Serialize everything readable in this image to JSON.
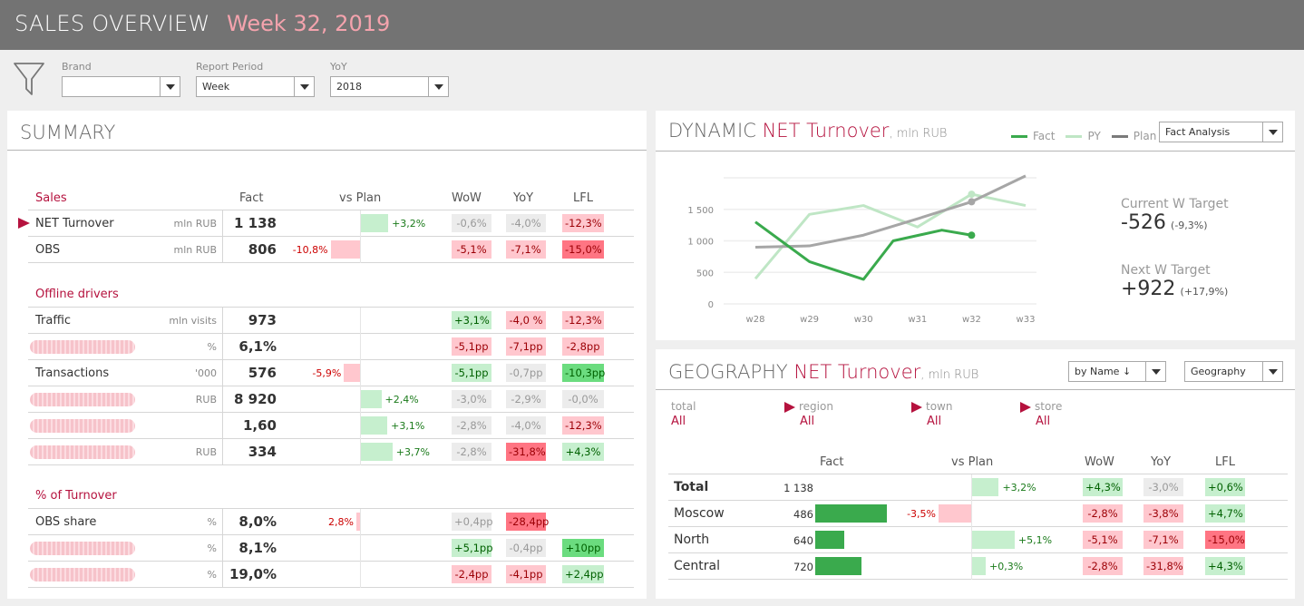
{
  "header": {
    "title": "SALES OVERVIEW",
    "period": "Week 32, 2019"
  },
  "filters": [
    {
      "label": "Brand",
      "value": ""
    },
    {
      "label": "Report Period",
      "value": "Week"
    },
    {
      "label": "YoY",
      "value": "2018"
    }
  ],
  "summary": {
    "title": "SUMMARY",
    "columns": [
      "Fact",
      "vs Plan",
      "WoW",
      "YoY",
      "LFL"
    ],
    "sections": [
      {
        "label": "Sales",
        "rows": [
          {
            "name": "NET Turnover",
            "unit": "mln RUB",
            "fact": "1 138",
            "vs_plan": "+3,2%",
            "vs_plan_value": 3.2,
            "wow": "-0,6%",
            "wow_style": "gray",
            "yoy": "-4,0%",
            "yoy_style": "gray",
            "lfl": "-12,3%",
            "lfl_style": "pink",
            "selected": true
          },
          {
            "name": "OBS",
            "unit": "mln RUB",
            "fact": "806",
            "vs_plan": "-10,8%",
            "vs_plan_value": -10.8,
            "wow": "-5,1%",
            "wow_style": "pink",
            "yoy": "-7,1%",
            "yoy_style": "pink",
            "lfl": "-15,0%",
            "lfl_style": "dpink"
          }
        ]
      },
      {
        "label": "Offline drivers",
        "rows": [
          {
            "name": "Traffic",
            "unit": "mln visits",
            "fact": "973",
            "vs_plan": "",
            "vs_plan_value": 0,
            "wow": "+3,1%",
            "wow_style": "lgreen",
            "yoy": "-4,0 %",
            "yoy_style": "pink",
            "lfl": "-12,3%",
            "lfl_style": "pink"
          },
          {
            "name": "",
            "redacted": true,
            "unit": "%",
            "fact": "6,1%",
            "vs_plan": "",
            "vs_plan_value": 0,
            "wow": "-5,1pp",
            "wow_style": "pink",
            "yoy": "-7,1pp",
            "yoy_style": "pink",
            "lfl": "-2,8pp",
            "lfl_style": "pink"
          },
          {
            "name": "Transactions",
            "unit": "'000",
            "fact": "576",
            "vs_plan": "-5,9%",
            "vs_plan_value": -5.9,
            "wow": "-5,1pp",
            "wow_style": "lgreen",
            "yoy": "-0,7pp",
            "yoy_style": "gray",
            "lfl": "-10,3pp",
            "lfl_style": "dgreen"
          },
          {
            "name": "",
            "redacted": true,
            "unit": "RUB",
            "fact": "8 920",
            "vs_plan": "+2,4%",
            "vs_plan_value": 2.4,
            "wow": "-3,0%",
            "wow_style": "gray",
            "yoy": "-2,9%",
            "yoy_style": "gray",
            "lfl": "-0,0%",
            "lfl_style": "gray"
          },
          {
            "name": "",
            "redacted": true,
            "unit": "",
            "fact": "1,60",
            "vs_plan": "+3,1%",
            "vs_plan_value": 3.1,
            "wow": "-2,8%",
            "wow_style": "gray",
            "yoy": "-4,0%",
            "yoy_style": "gray",
            "lfl": "-12,3%",
            "lfl_style": "pink"
          },
          {
            "name": "",
            "redacted": true,
            "unit": "RUB",
            "fact": "334",
            "vs_plan": "+3,7%",
            "vs_plan_value": 3.7,
            "wow": "-2,8%",
            "wow_style": "gray",
            "yoy": "-31,8%",
            "yoy_style": "dpink",
            "lfl": "+4,3%",
            "lfl_style": "lgreen"
          }
        ]
      },
      {
        "label": "% of Turnover",
        "rows": [
          {
            "name": "OBS share",
            "unit": "%",
            "fact": "8,0%",
            "vs_plan": "2,8%",
            "vs_plan_value": -0.5,
            "wow": "+0,4pp",
            "wow_style": "gray",
            "yoy": "-28,4pp",
            "yoy_style": "dpink",
            "lfl": "",
            "lfl_style": ""
          },
          {
            "name": "",
            "redacted": true,
            "unit": "%",
            "fact": "8,1%",
            "vs_plan": "",
            "vs_plan_value": 0,
            "wow": "+5,1pp",
            "wow_style": "lgreen",
            "yoy": "-0,4pp",
            "yoy_style": "gray",
            "lfl": "+10pp",
            "lfl_style": "dgreen"
          },
          {
            "name": "",
            "redacted": true,
            "unit": "%",
            "fact": "19,0%",
            "vs_plan": "",
            "vs_plan_value": 0,
            "wow": "-2,4pp",
            "wow_style": "pink",
            "yoy": "-4,1pp",
            "yoy_style": "pink",
            "lfl": "+2,4pp",
            "lfl_style": "lgreen"
          }
        ]
      }
    ]
  },
  "dynamic": {
    "title_prefix": "DYNAMIC",
    "title_metric": "NET Turnover",
    "title_unit": ", mln RUB",
    "legend": [
      {
        "name": "Fact",
        "color": "#3aaa4d"
      },
      {
        "name": "PY",
        "color": "#bfe6c5"
      },
      {
        "name": "Plan",
        "color": "#a6a6a6"
      }
    ],
    "mode_dropdown": "Fact Analysis",
    "current_target": {
      "label": "Current W Target",
      "value": "-526",
      "pct": "(-9,3%)"
    },
    "next_target": {
      "label": "Next W Target",
      "value": "+922",
      "pct": "(+17,9%)"
    }
  },
  "chart_data": {
    "type": "line",
    "title": "DYNAMIC NET Turnover, mln RUB",
    "categories": [
      "w28",
      "w29",
      "w30",
      "w31",
      "w32",
      "w33"
    ],
    "yticks": [
      "0",
      "500",
      "1 000",
      "1 500"
    ],
    "ylim": [
      0,
      2000
    ],
    "grid": true,
    "legend_position": "top-right",
    "series": [
      {
        "name": "Fact",
        "color": "#3aaa4d",
        "x": [
          0,
          1,
          2,
          2.55,
          3.45,
          4
        ],
        "values": [
          1300,
          670,
          390,
          1000,
          1170,
          1090
        ],
        "end_marker": true
      },
      {
        "name": "PY",
        "color": "#bfe6c5",
        "x": [
          0,
          1,
          2,
          3,
          4,
          5
        ],
        "values": [
          400,
          1420,
          1560,
          1220,
          1740,
          1560
        ]
      },
      {
        "name": "Plan",
        "color": "#a6a6a6",
        "x": [
          0,
          1,
          2,
          3,
          4,
          5
        ],
        "values": [
          900,
          920,
          1090,
          1350,
          1620,
          2030
        ],
        "marker_at": 4
      }
    ]
  },
  "geography": {
    "title_prefix": "GEOGRAPHY",
    "title_metric": "NET Turnover",
    "title_unit": ", mln RUB",
    "sort_dropdown": "by Name ↓",
    "dimension_dropdown": "Geography",
    "breadcrumbs": [
      {
        "label": "total",
        "value": "All"
      },
      {
        "label": "region",
        "value": "All"
      },
      {
        "label": "town",
        "value": "All"
      },
      {
        "label": "store",
        "value": "All"
      }
    ],
    "columns": [
      "Fact",
      "vs Plan",
      "WoW",
      "YoY",
      "LFL"
    ],
    "rows": [
      {
        "name": "Total",
        "bold": true,
        "fact": "1 138",
        "fact_value": 1138,
        "vs_plan": "+3,2%",
        "vs_plan_value": 3.2,
        "wow": "+4,3%",
        "wow_style": "lgreen",
        "yoy": "-3,0%",
        "yoy_style": "gray",
        "lfl": "+0,6%",
        "lfl_style": "lgreen"
      },
      {
        "name": "Moscow",
        "fact": "486",
        "fact_value": 486,
        "vs_plan": "-3,5%",
        "vs_plan_value": -3.5,
        "wow": "-2,8%",
        "wow_style": "pink",
        "yoy": "-3,8%",
        "yoy_style": "pink",
        "lfl": "+4,7%",
        "lfl_style": "lgreen"
      },
      {
        "name": "North",
        "fact": "640",
        "fact_value": 640,
        "vs_plan": "+5,1%",
        "vs_plan_value": 5.1,
        "wow": "-5,1%",
        "wow_style": "pink",
        "yoy": "-7,1%",
        "yoy_style": "pink",
        "lfl": "-15,0%",
        "lfl_style": "dpink"
      },
      {
        "name": "Central",
        "fact": "720",
        "fact_value": 720,
        "vs_plan": "+0,3%",
        "vs_plan_value": 0.3,
        "wow": "-2,8%",
        "wow_style": "pink",
        "yoy": "-31,8%",
        "yoy_style": "pink",
        "lfl": "+4,3%",
        "lfl_style": "lgreen"
      }
    ]
  }
}
